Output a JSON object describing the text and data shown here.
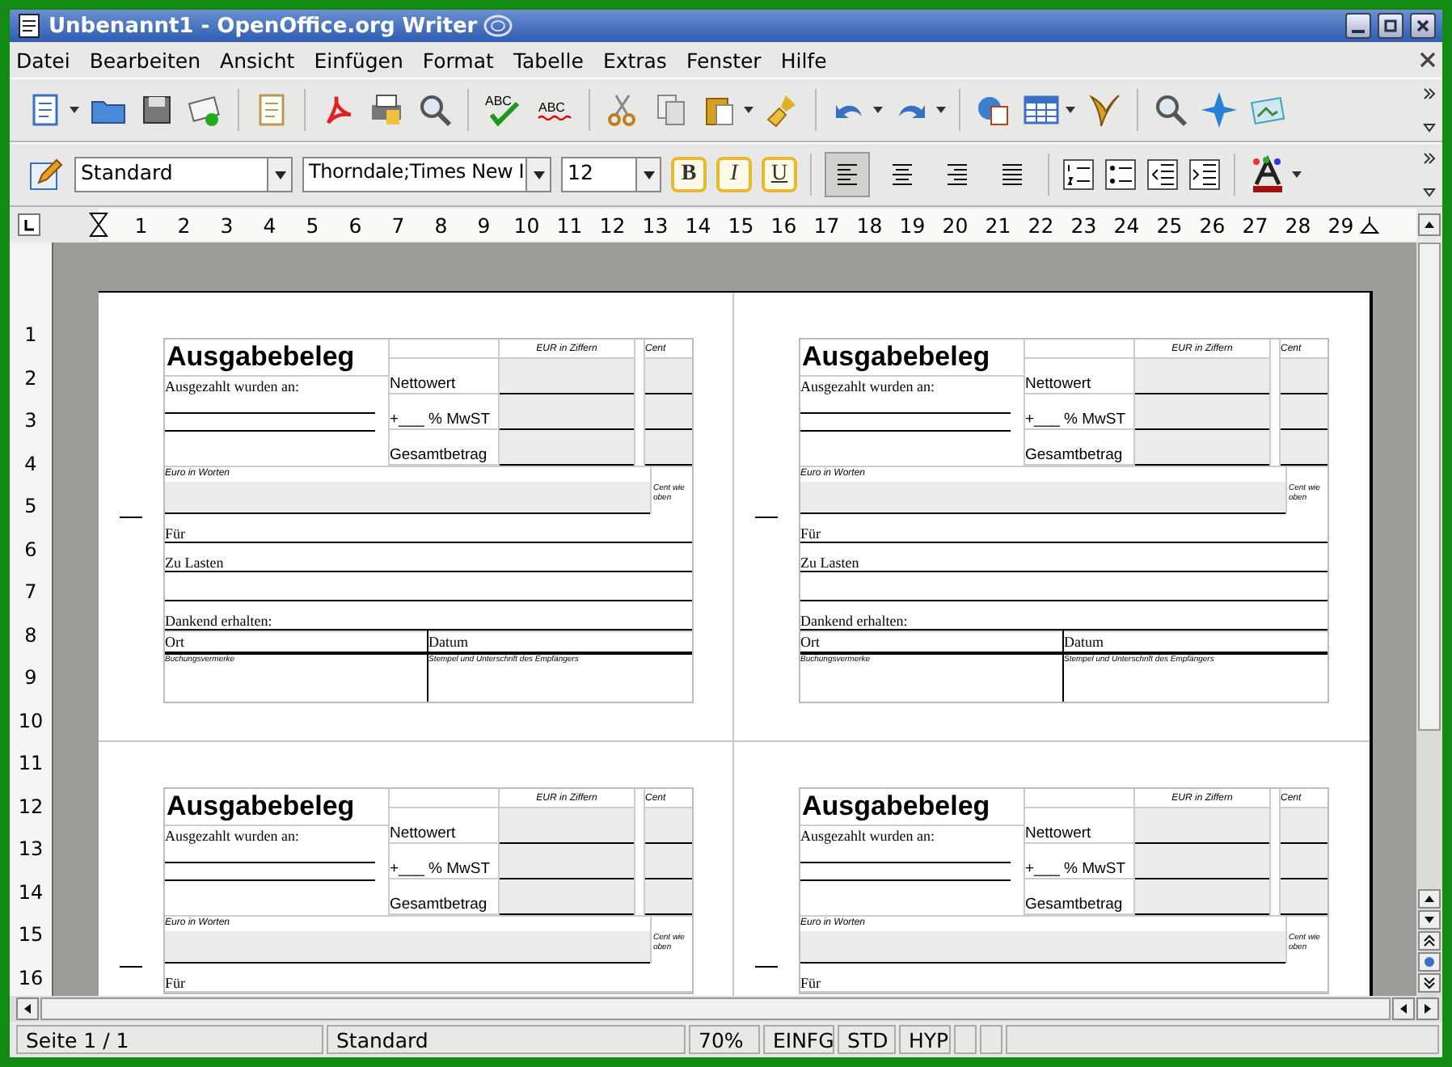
{
  "window": {
    "title": "Unbenannt1 - OpenOffice.org Writer"
  },
  "menu": [
    "Datei",
    "Bearbeiten",
    "Ansicht",
    "Einfügen",
    "Format",
    "Tabelle",
    "Extras",
    "Fenster",
    "Hilfe"
  ],
  "standard_toolbar": {
    "spellcheck_labels": [
      "ABC",
      "ABC"
    ]
  },
  "format_toolbar": {
    "style": "Standard",
    "font": "Thorndale;Times New I",
    "size": "12",
    "text_styles": [
      "B",
      "I",
      "U"
    ],
    "alignment": [
      {
        "selected": true
      },
      {
        "selected": false
      },
      {
        "selected": false
      },
      {
        "selected": false
      }
    ]
  },
  "ruler": {
    "horizontal": [
      "1",
      "2",
      "3",
      "4",
      "5",
      "6",
      "7",
      "8",
      "9",
      "10",
      "11",
      "12",
      "13",
      "14",
      "15",
      "16",
      "17",
      "18",
      "19",
      "20",
      "21",
      "22",
      "23",
      "24",
      "25",
      "26",
      "27",
      "28",
      "29"
    ],
    "vertical": [
      "1",
      "2",
      "3",
      "4",
      "5",
      "6",
      "7",
      "8",
      "9",
      "10",
      "11",
      "12",
      "13",
      "14",
      "15",
      "16"
    ]
  },
  "receipts": [
    {
      "title": "Ausgabebeleg",
      "paid_to": "Ausgezahlt wurden an:",
      "col_eur": "EUR in Ziffern",
      "col_cent": "Cent",
      "amount_lines": [
        "Nettowert",
        "+___ % MwST",
        "Gesamtbetrag"
      ],
      "words_label": "Euro in Worten",
      "cent_note": "Cent wie oben",
      "rows": [
        "Für",
        "Zu Lasten",
        "",
        "Dankend erhalten:"
      ],
      "place": "Ort",
      "date": "Datum",
      "note_left": "Buchungsvermerke",
      "note_right": "Stempel und Unterschrift des Empfängers"
    },
    {
      "title": "Ausgabebeleg",
      "paid_to": "Ausgezahlt wurden an:",
      "col_eur": "EUR in Ziffern",
      "col_cent": "Cent",
      "amount_lines": [
        "Nettowert",
        "+___ % MwST",
        "Gesamtbetrag"
      ],
      "words_label": "Euro in Worten",
      "cent_note": "Cent wie oben",
      "rows": [
        "Für",
        "Zu Lasten",
        "",
        "Dankend erhalten:"
      ],
      "place": "Ort",
      "date": "Datum",
      "note_left": "Buchungsvermerke",
      "note_right": "Stempel und Unterschrift des Empfängers"
    },
    {
      "title": "Ausgabebeleg",
      "paid_to": "Ausgezahlt wurden an:",
      "col_eur": "EUR in Ziffern",
      "col_cent": "Cent",
      "amount_lines": [
        "Nettowert",
        "+___ % MwST",
        "Gesamtbetrag"
      ],
      "words_label": "Euro in Worten",
      "cent_note": "Cent wie oben",
      "rows": [
        "Für"
      ]
    },
    {
      "title": "Ausgabebeleg",
      "paid_to": "Ausgezahlt wurden an:",
      "col_eur": "EUR in Ziffern",
      "col_cent": "Cent",
      "amount_lines": [
        "Nettowert",
        "+___ % MwST",
        "Gesamtbetrag"
      ],
      "words_label": "Euro in Worten",
      "cent_note": "Cent wie oben",
      "rows": [
        "Für"
      ]
    }
  ],
  "status_bar": {
    "page": "Seite 1 / 1",
    "style": "Standard",
    "zoom": "70%",
    "insert_mode": "EINFG",
    "selection_mode": "STD",
    "hyphenation": "HYP"
  }
}
